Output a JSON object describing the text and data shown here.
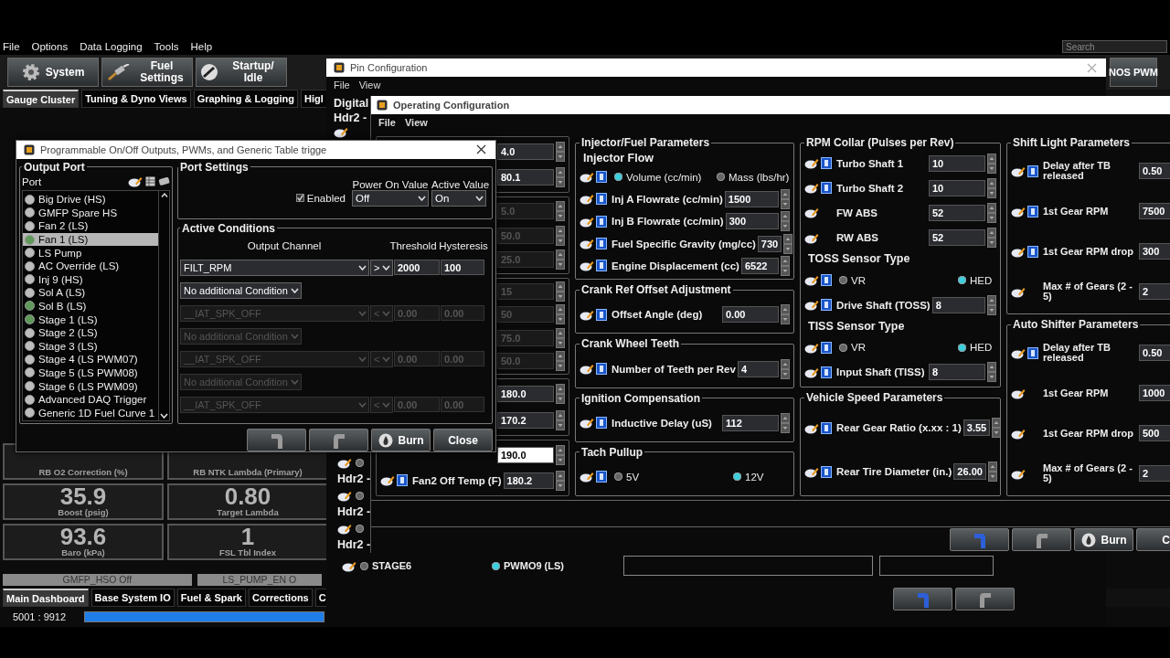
{
  "app": {
    "menu": [
      "File",
      "Options",
      "Data Logging",
      "Tools",
      "Help"
    ],
    "search": {
      "placeholder": "Search"
    },
    "toolbar": [
      {
        "label": "System"
      },
      {
        "label": "Fuel Settings"
      },
      {
        "label": "Startup/ Idle"
      },
      {
        "label": "NOS PWM"
      }
    ],
    "tabs": [
      {
        "label": "Gauge Cluster",
        "selected": true
      },
      {
        "label": "Tuning & Dyno Views",
        "selected": false
      },
      {
        "label": "Graphing & Logging",
        "selected": false
      },
      {
        "label": "Higl",
        "selected": false
      }
    ],
    "gauges": [
      {
        "label": "RB O2 Correction (%)"
      },
      {
        "label": "RB NTK Lambda (Primary)"
      },
      {
        "value": "35.9",
        "label": "Boost (psig)"
      },
      {
        "value": "0.80",
        "label": "Target Lambda"
      },
      {
        "value": "93.6",
        "label": "Baro (kPa)"
      },
      {
        "value": "1",
        "label": "FSL Tbl Index"
      }
    ],
    "indicators": [
      "GMFP_HSO Off",
      "LS_PUMP_EN O"
    ],
    "bottom_tabs": [
      {
        "label": "Main Dashboard",
        "selected": true
      },
      {
        "label": "Base System IO",
        "selected": false
      },
      {
        "label": "Fuel & Spark",
        "selected": false
      },
      {
        "label": "Corrections",
        "selected": false
      },
      {
        "label": "C",
        "selected": false
      }
    ],
    "status": {
      "counter": "5001 : 9912",
      "level": 1
    }
  },
  "pin_window": {
    "title": "Pin Configuration",
    "menu": [
      "File",
      "View"
    ],
    "group": "Digital",
    "top_label": "Hdr2 -",
    "channels": [
      {
        "label": "Hdr2 -",
        "selected": false
      },
      {
        "label": "Hdr2 -",
        "selected": false
      },
      {
        "label": "Hdr2 -",
        "selected": false
      }
    ],
    "radio_row": [
      {
        "label": "STAGE6",
        "selected": false
      },
      {
        "label": "PWMO9 (LS)",
        "selected": true
      }
    ],
    "buttons": [
      {
        "kind": "undo"
      },
      {
        "kind": "redo"
      }
    ]
  },
  "op_window": {
    "title": "Operating Configuration",
    "menu": [
      "File",
      "View"
    ],
    "columns": [
      [
        {
          "rows": [
            {
              "kind": "value",
              "value": "4.0",
              "disabled": false
            },
            {
              "kind": "value",
              "value": "80.1",
              "disabled": false
            }
          ]
        },
        {
          "rows": [
            {
              "kind": "value",
              "value": "5.0",
              "disabled": true
            },
            {
              "kind": "value",
              "value": "50.0",
              "disabled": true
            },
            {
              "kind": "value",
              "value": "25.0",
              "disabled": true
            }
          ]
        },
        {
          "rows": [
            {
              "kind": "value",
              "value": "15",
              "disabled": true
            },
            {
              "kind": "value",
              "value": "50",
              "disabled": true
            },
            {
              "kind": "value",
              "value": "75.0",
              "disabled": true
            },
            {
              "kind": "value",
              "value": "50.0",
              "disabled": true
            }
          ]
        },
        {
          "rows": [
            {
              "kind": "value",
              "value": "180.0",
              "disabled": false
            },
            {
              "kind": "value",
              "value": "170.2",
              "disabled": false
            }
          ]
        },
        {
          "rows": [
            {
              "kind": "value",
              "value": "190.0",
              "disabled": false
            },
            {
              "kind": "field",
              "label": "Fan2 Off Temp (F)",
              "value": "180.2",
              "help": true
            }
          ]
        }
      ],
      [
        {
          "title": "Injector/Fuel Parameters",
          "rows": [
            {
              "kind": "subheading",
              "label": "Injector Flow"
            },
            {
              "kind": "radio",
              "help": true,
              "options": [
                {
                  "label": "Volume (cc/min)",
                  "selected": true
                },
                {
                  "label": "Mass (lbs/hr)",
                  "selected": false
                }
              ]
            },
            {
              "kind": "field",
              "label": "Inj A Flowrate (cc/min)",
              "value": "1500",
              "help": true
            },
            {
              "kind": "field",
              "label": "Inj B Flowrate (cc/min)",
              "value": "300",
              "help": true
            },
            {
              "kind": "field",
              "label": "Fuel Specific Gravity (mg/cc)",
              "value": "730",
              "help": true
            },
            {
              "kind": "field",
              "label": "Engine Displacement (cc)",
              "value": "6522",
              "help": true
            }
          ]
        },
        {
          "title": "Crank Ref Offset Adjustment",
          "rows": [
            {
              "kind": "field",
              "label": "Offset Angle  (deg)",
              "value": "0.00",
              "help": true
            }
          ]
        },
        {
          "title": "Crank Wheel Teeth",
          "rows": [
            {
              "kind": "field",
              "label": "Number of Teeth per Rev",
              "value": "4",
              "help": true
            }
          ]
        },
        {
          "title": "Ignition Compensation",
          "rows": [
            {
              "kind": "field",
              "label": "Inductive Delay (uS)",
              "value": "112",
              "help": true
            }
          ]
        },
        {
          "title": "Tach Pullup",
          "rows": [
            {
              "kind": "radio",
              "help": true,
              "options": [
                {
                  "label": "5V",
                  "selected": false
                },
                {
                  "label": "12V",
                  "selected": true
                }
              ]
            }
          ]
        }
      ],
      [
        {
          "title": "RPM Collar (Pulses per Rev)",
          "rows": [
            {
              "kind": "field",
              "label": "Turbo Shaft 1",
              "value": "10",
              "help": true
            },
            {
              "kind": "field",
              "label": "Turbo Shaft 2",
              "value": "10",
              "help": true
            },
            {
              "kind": "field",
              "label": "FW ABS",
              "value": "52",
              "help": false
            },
            {
              "kind": "field",
              "label": "RW ABS",
              "value": "52",
              "help": false
            },
            {
              "kind": "subheading",
              "label": "TOSS Sensor Type"
            },
            {
              "kind": "radio",
              "help": true,
              "options": [
                {
                  "label": "VR",
                  "selected": false
                },
                {
                  "label": "HED",
                  "selected": true
                }
              ]
            },
            {
              "kind": "field",
              "label": "Drive Shaft (TOSS)",
              "value": "8",
              "help": true
            },
            {
              "kind": "subheading",
              "label": "TISS Sensor Type"
            },
            {
              "kind": "radio",
              "help": true,
              "options": [
                {
                  "label": "VR",
                  "selected": false
                },
                {
                  "label": "HED",
                  "selected": true
                }
              ]
            },
            {
              "kind": "field",
              "label": "Input Shaft (TISS)",
              "value": "8",
              "help": true
            }
          ]
        },
        {
          "title": "Vehicle Speed Parameters",
          "rows": [
            {
              "kind": "field",
              "label": "Rear Gear Ratio (x.xx : 1)",
              "value": "3.55",
              "help": true
            },
            {
              "kind": "field",
              "label": "Rear Tire Diameter (in.)",
              "value": "26.00",
              "help": true
            }
          ]
        }
      ],
      [
        {
          "title": "Shift Light Parameters",
          "rows": [
            {
              "kind": "field",
              "label": "Delay after TB released",
              "value": "0.50",
              "help": true
            },
            {
              "kind": "field",
              "label": "1st Gear RPM",
              "value": "7500",
              "help": true
            },
            {
              "kind": "field",
              "label": "1st Gear RPM drop",
              "value": "300",
              "help": true
            },
            {
              "kind": "field",
              "label": "Max # of Gears (2 - 5)",
              "value": "2",
              "help": false
            }
          ]
        },
        {
          "title": "Auto Shifter Parameters",
          "rows": [
            {
              "kind": "field",
              "label": "Delay after TB released",
              "value": "0.50",
              "help": true
            },
            {
              "kind": "field",
              "label": "1st Gear RPM",
              "value": "1000",
              "help": false
            },
            {
              "kind": "field",
              "label": "1st Gear RPM drop",
              "value": "500",
              "help": false
            },
            {
              "kind": "field",
              "label": "Max # of Gears (2 - 5)",
              "value": "2",
              "help": false
            }
          ]
        }
      ]
    ],
    "buttons": [
      {
        "kind": "undo"
      },
      {
        "kind": "redo"
      },
      {
        "kind": "burn",
        "label": "Burn"
      },
      {
        "kind": "close",
        "label": "C"
      }
    ]
  },
  "dialog": {
    "title": "Programmable On/Off Outputs, PWMs, and Generic Table trigge",
    "output_port": {
      "heading": "Output Port",
      "column": "Port",
      "items": [
        {
          "label": "Big Drive (HS)",
          "active": false,
          "selected": false
        },
        {
          "label": "GMFP Spare HS",
          "active": false,
          "selected": false
        },
        {
          "label": "Fan 2 (LS)",
          "active": false,
          "selected": false
        },
        {
          "label": "Fan 1 (LS)",
          "active": true,
          "selected": true
        },
        {
          "label": "LS Pump",
          "active": false,
          "selected": false
        },
        {
          "label": "AC Override (LS)",
          "active": false,
          "selected": false
        },
        {
          "label": "Inj 9 (HS)",
          "active": false,
          "selected": false
        },
        {
          "label": "Sol A (LS)",
          "active": false,
          "selected": false
        },
        {
          "label": "Sol B (LS)",
          "active": true,
          "selected": false
        },
        {
          "label": "Stage 1 (LS)",
          "active": true,
          "selected": false
        },
        {
          "label": "Stage 2 (LS)",
          "active": false,
          "selected": false
        },
        {
          "label": "Stage 3 (LS)",
          "active": false,
          "selected": false
        },
        {
          "label": "Stage 4 (LS PWM07)",
          "active": false,
          "selected": false
        },
        {
          "label": "Stage 5 (LS PWM08)",
          "active": false,
          "selected": false
        },
        {
          "label": "Stage 6 (LS PWM09)",
          "active": false,
          "selected": false
        },
        {
          "label": "Advanced DAQ Trigger",
          "active": false,
          "selected": false
        },
        {
          "label": "Generic 1D Fuel Curve 1",
          "active": false,
          "selected": false
        }
      ]
    },
    "port_settings": {
      "heading": "Port Settings",
      "enabled": {
        "label": "Enabled",
        "checked": true
      },
      "power_on": {
        "label": "Power On Value",
        "value": "Off"
      },
      "active_value": {
        "label": "Active Value",
        "value": "On"
      }
    },
    "conditions": {
      "heading": "Active Conditions",
      "columns": [
        "Output Channel",
        "Threshold",
        "Hysteresis"
      ],
      "rows": [
        {
          "kind": "condition",
          "channel": "FILT_RPM",
          "op": ">",
          "threshold": "2000",
          "hysteresis": "100",
          "disabled": false
        },
        {
          "kind": "join",
          "value": "No additional Condition",
          "disabled": false
        },
        {
          "kind": "condition",
          "channel": "__IAT_SPK_OFF",
          "op": "<",
          "threshold": "0.00",
          "hysteresis": "0.00",
          "disabled": true
        },
        {
          "kind": "join",
          "value": "No additional Condition",
          "disabled": true
        },
        {
          "kind": "condition",
          "channel": "__IAT_SPK_OFF",
          "op": "<",
          "threshold": "0.00",
          "hysteresis": "0.00",
          "disabled": true
        },
        {
          "kind": "join",
          "value": "No additional Condition",
          "disabled": true
        },
        {
          "kind": "condition",
          "channel": "__IAT_SPK_OFF",
          "op": "<",
          "threshold": "0.00",
          "hysteresis": "0.00",
          "disabled": true
        }
      ]
    },
    "buttons": [
      {
        "kind": "undo"
      },
      {
        "kind": "redo"
      },
      {
        "kind": "burn",
        "label": "Burn"
      },
      {
        "kind": "close",
        "label": "Close"
      }
    ]
  }
}
